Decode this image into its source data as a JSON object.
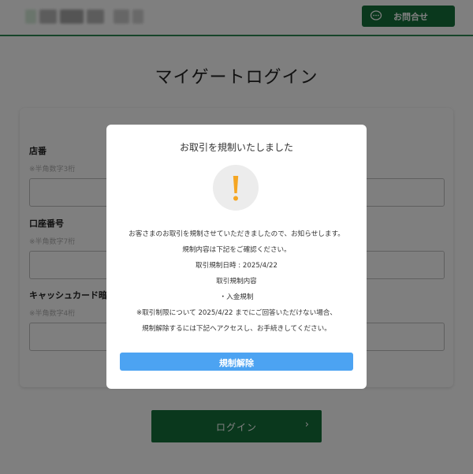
{
  "header": {
    "contact_button_label": "お問合せ",
    "contact_icon": "chat-bubble-icon"
  },
  "page": {
    "title": "マイゲートログイン"
  },
  "form": {
    "fields": [
      {
        "label": "店番",
        "note": "※半角数字3桁",
        "value": ""
      },
      {
        "label": "口座番号",
        "note": "※半角数字7桁",
        "value": ""
      },
      {
        "label": "キャッシュカード暗証",
        "note": "※半角数字4桁",
        "value": ""
      }
    ]
  },
  "login_button": {
    "label": "ログイン",
    "chevron": "›"
  },
  "modal": {
    "title": "お取引を規制いたしました",
    "icon": "warning-exclamation-icon",
    "lines": [
      "お客さまのお取引を規制させていただきましたので、お知らせします。",
      "規制内容は下記をご確認ください。",
      "取引規制日時 : 2025/4/22",
      "取引規制内容",
      "・入金規制",
      "※取引制限について 2025/4/22 までにご回答いただけない場合、",
      "規制解除するには下記へアクセスし、お手続きしてください。"
    ],
    "button_label": "規制解除"
  },
  "colors": {
    "brand_green": "#14713b",
    "release_blue": "#4ca3f2",
    "warning_orange": "#f5a623",
    "overlay": "rgba(0,0,0,0.5)"
  }
}
